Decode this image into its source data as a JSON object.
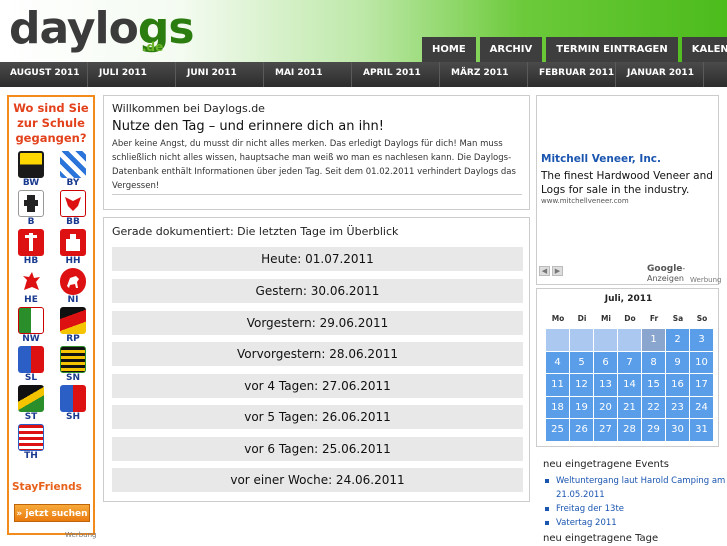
{
  "logo": {
    "main_dark": "daylo",
    "main_green": "gs",
    "sub": ".de"
  },
  "top_nav": [
    "HOME",
    "ARCHIV",
    "TERMIN EINTRAGEN",
    "KALENDER"
  ],
  "month_nav": [
    "AUGUST 2011",
    "JULI 2011",
    "JUNI 2011",
    "MAI 2011",
    "APRIL 2011",
    "MÄRZ 2011",
    "FEBRUAR 2011",
    "JANUAR 2011"
  ],
  "left_ad": {
    "title": "Wo sind Sie zur Schule gegangen?",
    "states": [
      "BW",
      "BY",
      "B",
      "BB",
      "HB",
      "HH",
      "HE",
      "NI",
      "NW",
      "RP",
      "SL",
      "SN",
      "ST",
      "SH",
      "TH"
    ],
    "brand": "StayFriends",
    "button": "» jetzt suchen",
    "werbung": "Werbung"
  },
  "welcome": {
    "greeting": "Willkommen bei Daylogs.de",
    "headline": "Nutze den Tag – und erinnere dich an ihn!",
    "body": "Aber keine Angst, du musst dir nicht alles merken. Das erledigt Daylogs für dich! Man muss schließlich nicht alles wissen, hauptsache man weiß wo man es nachlesen kann. Die Daylogs-Datenbank enthält Informationen über jeden Tag. Seit dem 01.02.2011 verhindert Daylogs das Vergessen!"
  },
  "days": {
    "heading": "Gerade dokumentiert: Die letzten Tage im Überblick",
    "rows": [
      "Heute: 01.07.2011",
      "Gestern: 30.06.2011",
      "Vorgestern: 29.06.2011",
      "Vorvorgestern: 28.06.2011",
      "vor 4 Tagen: 27.06.2011",
      "vor 5 Tagen: 26.06.2011",
      "vor 6 Tagen: 25.06.2011",
      "vor einer Woche: 24.06.2011"
    ]
  },
  "right_ad": {
    "title": "Mitchell Veneer, Inc.",
    "desc": "The finest Hardwood Veneer and Logs for sale in the industry.",
    "url": "www.mitchellveneer.com",
    "google": "Google",
    "anzeigen": "-Anzeigen",
    "werbung": "Werbung"
  },
  "calendar": {
    "month": "Juli, 2011",
    "weekdays": [
      "Mo",
      "Di",
      "Mi",
      "Do",
      "Fr",
      "Sa",
      "So"
    ],
    "weeks": [
      [
        "",
        "",
        "",
        "",
        "1",
        "2",
        "3"
      ],
      [
        "4",
        "5",
        "6",
        "7",
        "8",
        "9",
        "10"
      ],
      [
        "11",
        "12",
        "13",
        "14",
        "15",
        "16",
        "17"
      ],
      [
        "18",
        "19",
        "20",
        "21",
        "22",
        "23",
        "24"
      ],
      [
        "25",
        "26",
        "27",
        "28",
        "29",
        "30",
        "31"
      ]
    ],
    "today": "1"
  },
  "events": {
    "heading": "neu eingetragene Events",
    "items": [
      "Weltuntergang laut Harold Camping am 21.05.2011",
      "Freitag der 13te",
      "Vatertag 2011"
    ],
    "heading2": "neu eingetragene Tage"
  }
}
